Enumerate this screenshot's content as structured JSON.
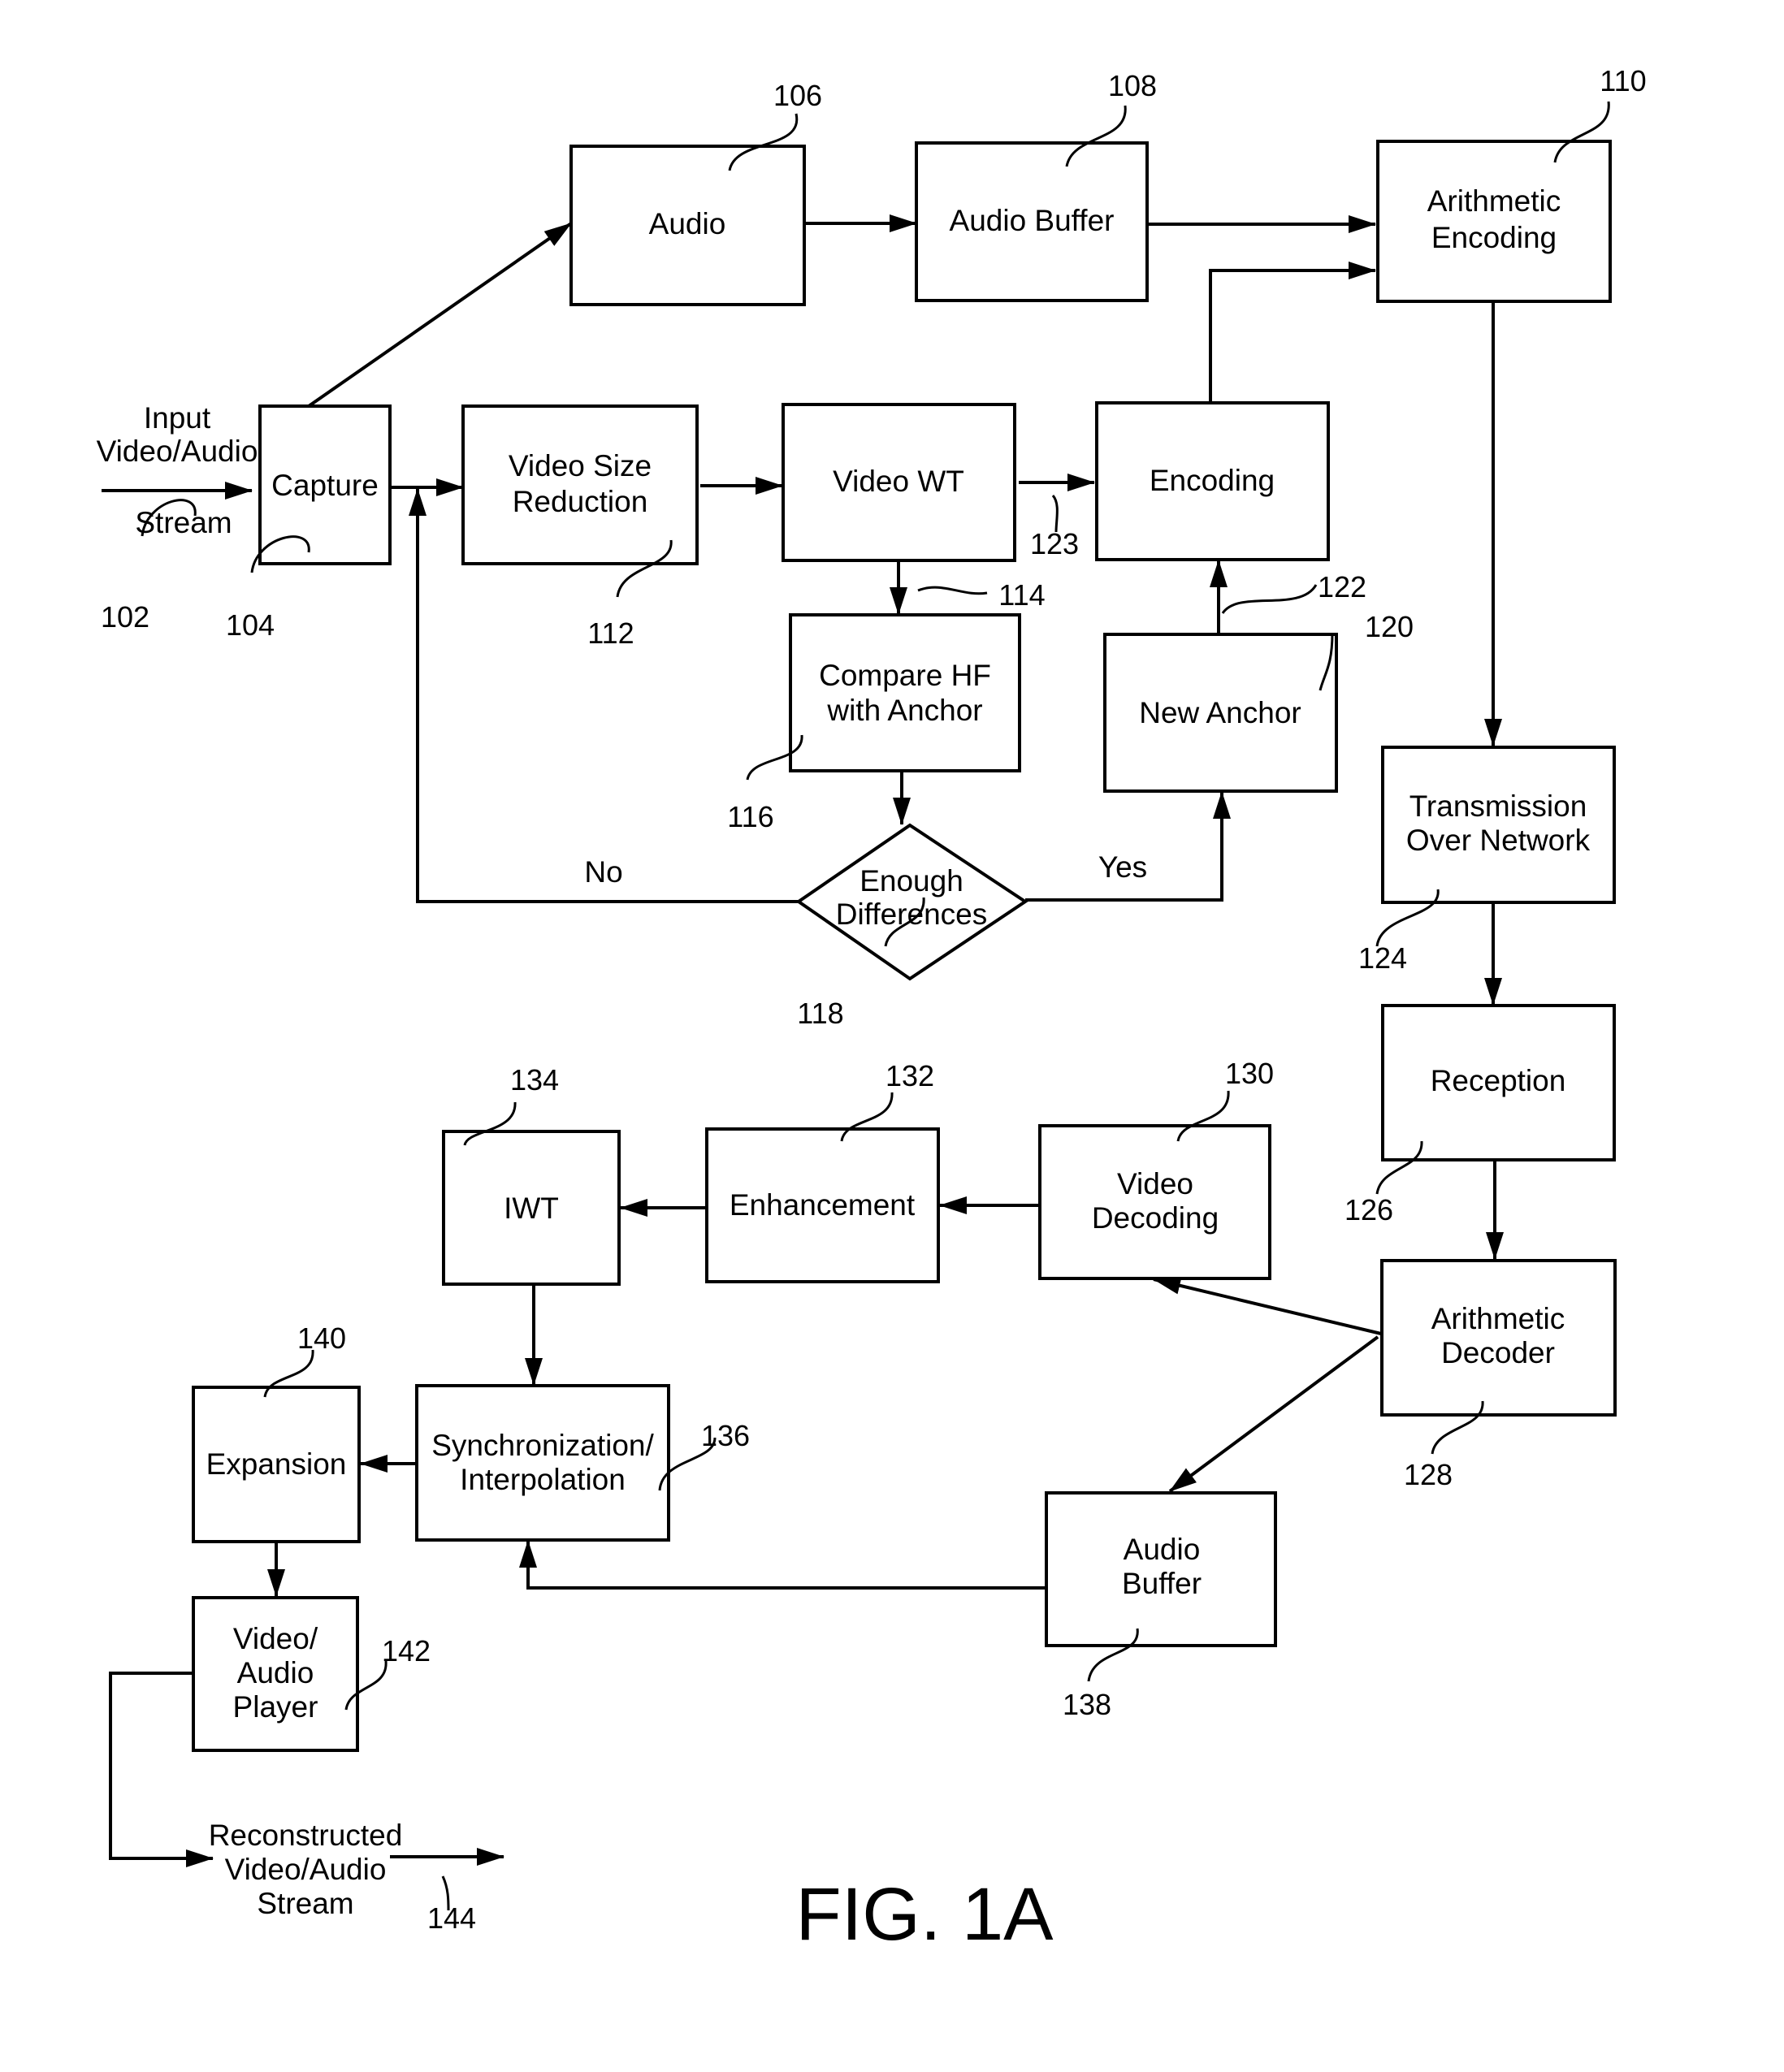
{
  "figure": {
    "caption": "FIG. 1A"
  },
  "nodes": {
    "capture": {
      "lines": [
        "Capture"
      ],
      "ref": "104"
    },
    "audio": {
      "lines": [
        "Audio"
      ],
      "ref": "106"
    },
    "audio_buffer_top": {
      "lines": [
        "Audio Buffer"
      ],
      "ref": "108"
    },
    "arithmetic_encoding": {
      "lines": [
        "Arithmetic",
        "Encoding"
      ],
      "ref": "110"
    },
    "video_size_reduction": {
      "lines": [
        "Video Size",
        "Reduction"
      ],
      "ref": "112"
    },
    "video_wt": {
      "lines": [
        "Video WT"
      ],
      "ref": "114"
    },
    "compare_hf": {
      "lines": [
        "Compare HF",
        "with Anchor"
      ],
      "ref": "116"
    },
    "enough_differences": {
      "lines": [
        "Enough",
        "Differences"
      ],
      "ref": "118"
    },
    "new_anchor": {
      "lines": [
        "New Anchor"
      ],
      "ref": "120"
    },
    "encoding": {
      "lines": [
        "Encoding"
      ],
      "ref": "122"
    },
    "transmission": {
      "lines": [
        "Transmission",
        "Over Network"
      ],
      "ref": "124"
    },
    "reception": {
      "lines": [
        "Reception"
      ],
      "ref": "126"
    },
    "arithmetic_decoder": {
      "lines": [
        "Arithmetic",
        "Decoder"
      ],
      "ref": "128"
    },
    "video_decoding": {
      "lines": [
        "Video",
        "Decoding"
      ],
      "ref": "130"
    },
    "enhancement": {
      "lines": [
        "Enhancement"
      ],
      "ref": "132"
    },
    "iwt": {
      "lines": [
        "IWT"
      ],
      "ref": "134"
    },
    "sync_interp": {
      "lines": [
        "Synchronization/",
        "Interpolation"
      ],
      "ref": "136"
    },
    "audio_buffer_bottom": {
      "lines": [
        "Audio",
        "Buffer"
      ],
      "ref": "138"
    },
    "expansion": {
      "lines": [
        "Expansion"
      ],
      "ref": "140"
    },
    "player": {
      "lines": [
        "Video/",
        "Audio",
        "Player"
      ],
      "ref": "142"
    }
  },
  "terminals": {
    "input": {
      "lines": [
        "Input",
        "Video/Audio",
        "Stream"
      ],
      "ref": "102"
    },
    "output": {
      "lines": [
        "Reconstructed",
        "Video/Audio",
        "Stream"
      ],
      "ref": "144"
    }
  },
  "edge_labels": {
    "no": "No",
    "yes": "Yes",
    "wt_to_encoding_ref": "123",
    "new_anchor_to_encoding_ref": "122",
    "wt_to_compare_ref": "114"
  }
}
